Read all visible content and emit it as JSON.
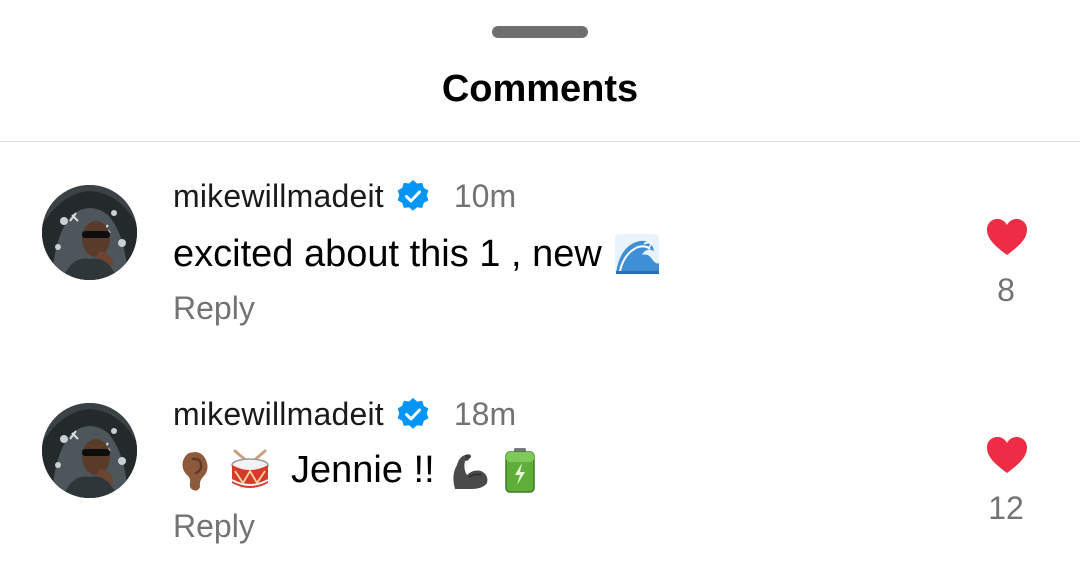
{
  "sheet": {
    "title": "Comments"
  },
  "comments": [
    {
      "username": "mikewillmadeit",
      "verified": true,
      "time": "10m",
      "text": "excited about this 1 , new",
      "emojis": [
        "water-wave-emoji"
      ],
      "reply_label": "Reply",
      "likes": "8",
      "liked": true
    },
    {
      "username": "mikewillmadeit",
      "verified": true,
      "time": "18m",
      "text": "Jennie !!",
      "emojis_before": [
        "ear-emoji",
        "drum-emoji"
      ],
      "emojis_after": [
        "flexed-biceps-emoji",
        "battery-emoji"
      ],
      "reply_label": "Reply",
      "likes": "12",
      "liked": true
    }
  ],
  "colors": {
    "heart": "#ED2D45",
    "verified": "#0095F6",
    "secondary_text": "#737373"
  }
}
